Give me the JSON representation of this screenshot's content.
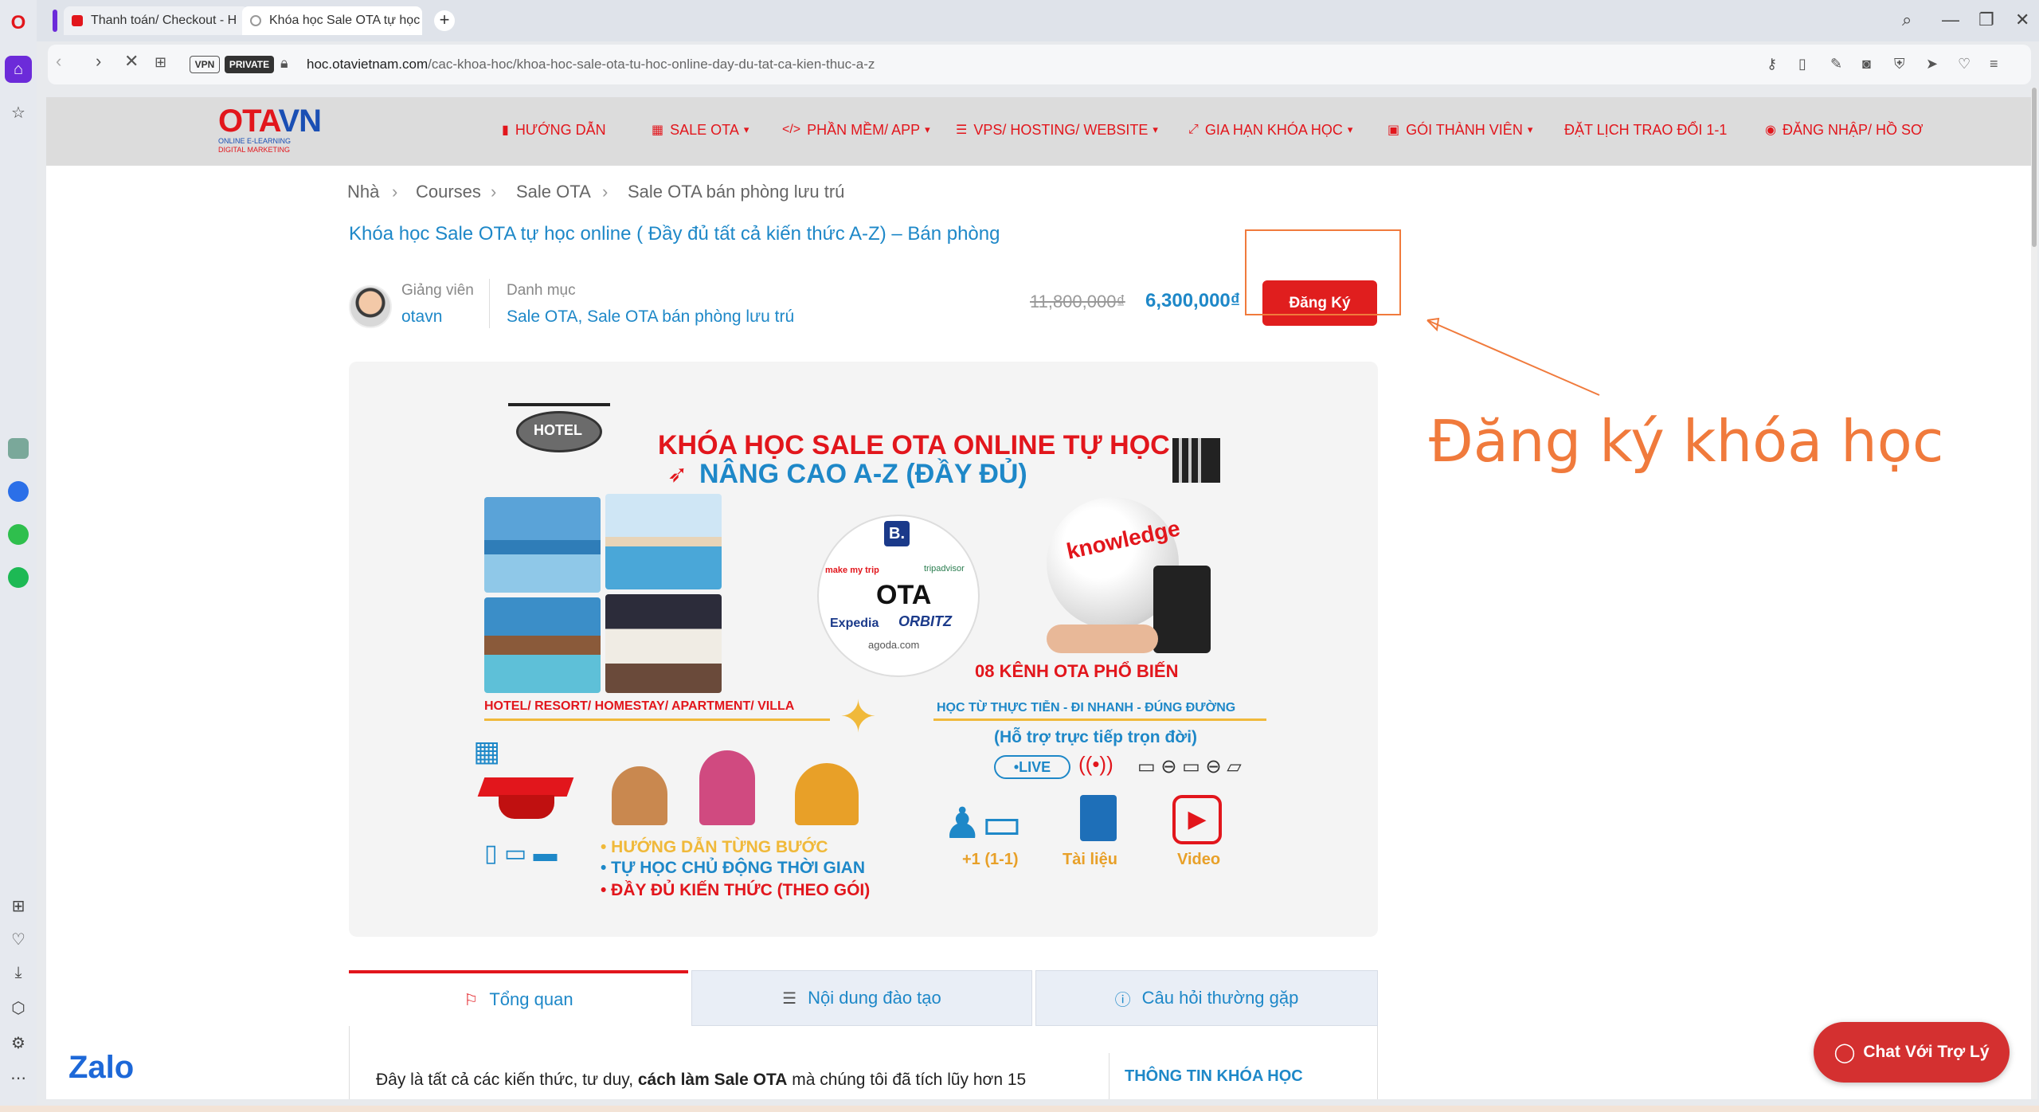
{
  "browser": {
    "tabs": [
      {
        "label": "Thanh toán/ Checkout - H",
        "active": false
      },
      {
        "label": "Khóa học Sale OTA tự học",
        "active": true
      }
    ],
    "url_domain": "hoc.otavietnam.com",
    "url_path": "/cac-khoa-hoc/khoa-hoc-sale-ota-tu-hoc-online-day-du-tat-ca-kien-thuc-a-z",
    "vpn_label": "VPN",
    "private_label": "PRIVATE"
  },
  "site": {
    "logo_text_red": "OTA",
    "logo_text_blue": "VN",
    "logo_sub1": "ONLINE E-LEARNING",
    "logo_sub2": "DIGITAL MARKETING",
    "menu": [
      {
        "label": "HƯỚNG DẪN",
        "icon": "book-icon",
        "caret": false
      },
      {
        "label": "SALE OTA",
        "icon": "building-icon",
        "caret": true
      },
      {
        "label": "PHẦN MỀM/ APP",
        "icon": "code-icon",
        "caret": true
      },
      {
        "label": "VPS/ HOSTING/ WEBSITE",
        "icon": "server-icon",
        "caret": true
      },
      {
        "label": "GIA HẠN KHÓA HỌC",
        "icon": "expand-icon",
        "caret": true
      },
      {
        "label": "GÓI THÀNH VIÊN",
        "icon": "calendar-icon",
        "caret": true
      },
      {
        "label": "ĐẶT LỊCH TRAO ĐỔI 1-1",
        "icon": "",
        "caret": false
      },
      {
        "label": "ĐĂNG NHẬP/ HỒ SƠ",
        "icon": "user-icon",
        "caret": false
      }
    ]
  },
  "breadcrumb": [
    "Nhà",
    "Courses",
    "Sale OTA",
    "Sale OTA bán phòng lưu trú"
  ],
  "course": {
    "title": "Khóa học Sale OTA tự học online ( Đầy đủ tất cả kiến thức A-Z) – Bán phòng",
    "instructor_label": "Giảng viên",
    "instructor_name": "otavn",
    "category_label": "Danh mục",
    "category_value": "Sale OTA, Sale OTA bán phòng lưu trú",
    "old_price": "11,800,000₫",
    "new_price": "6,300,000₫",
    "register_label": "Đăng Ký"
  },
  "annotation": {
    "text": "Đăng ký khóa học",
    "color": "#f07a3c"
  },
  "banner": {
    "headline1": "KHÓA HỌC SALE OTA ONLINE TỰ HỌC",
    "headline2": "NÂNG CAO A-Z (ĐẦY ĐỦ)",
    "hotel_sign": "HOTEL",
    "ota_center": "OTA",
    "ota_brands": [
      "B.",
      "make my trip",
      "tripadvisor",
      "Expedia",
      "ORBITZ",
      "agoda.com"
    ],
    "knowledge_word": "knowledge",
    "channels": "08 KÊNH OTA PHỔ BIẾN",
    "property_types": "HOTEL/ RESORT/ HOMESTAY/ APARTMENT/ VILLA",
    "learn_motto": "HỌC TỪ THỰC TIỄN - ĐI NHANH - ĐÚNG ĐƯỜNG",
    "support": "(Hỗ trợ trực tiếp trọn đời)",
    "live": "•LIVE",
    "bullets": [
      "• HƯỚNG DẪN TỪNG BƯỚC",
      "• TỰ HỌC CHỦ ĐỘNG THỜI GIAN",
      "• ĐẦY ĐỦ KIẾN THỨC (THEO GÓI)"
    ],
    "features": [
      "+1 (1-1)",
      "Tài liệu",
      "Video"
    ]
  },
  "content_tabs": [
    {
      "label": "Tổng quan",
      "icon": "bookmark-icon",
      "active": true
    },
    {
      "label": "Nội dung đào tạo",
      "icon": "list-icon",
      "active": false
    },
    {
      "label": "Câu hỏi thường gặp",
      "icon": "question-icon",
      "active": false
    }
  ],
  "intro": {
    "before": "Đây là tất cả các kiến thức, tư duy, ",
    "bold": "cách làm Sale OTA",
    "after": " mà chúng tôi đã tích lũy hơn 15"
  },
  "info_heading": "THÔNG TIN KHÓA HỌC",
  "zalo": "Zalo",
  "chat_button": "Chat Với Trợ Lý",
  "colors": {
    "brand_red": "#e2161c",
    "link_blue": "#1e88c8",
    "accent_orange": "#f07a3c"
  }
}
